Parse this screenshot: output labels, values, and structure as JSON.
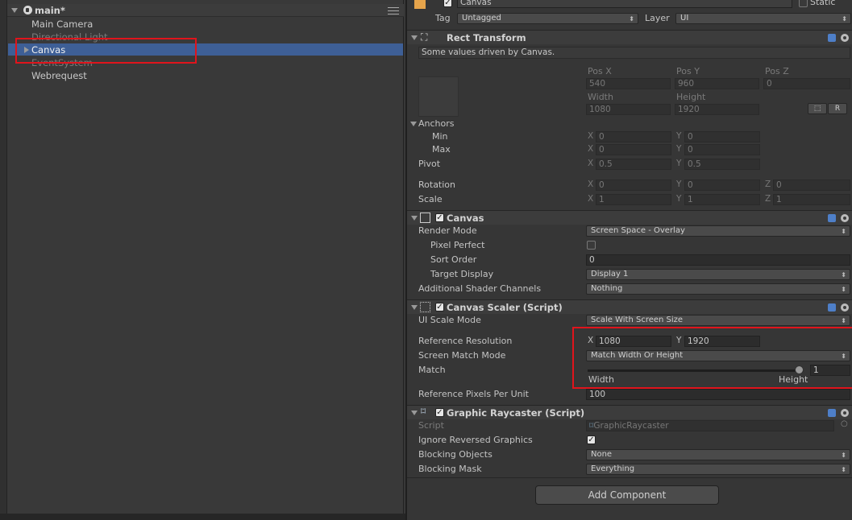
{
  "hierarchy": {
    "scene_title": "main*",
    "items": [
      {
        "label": "Main Camera"
      },
      {
        "label": "Directional Light"
      },
      {
        "label": "Canvas"
      },
      {
        "label": "EventSystem"
      },
      {
        "label": "Webrequest"
      }
    ]
  },
  "inspector": {
    "object_name": "Canvas",
    "static_label": "Static",
    "tag_label": "Tag",
    "tag_value": "Untagged",
    "layer_label": "Layer",
    "layer_value": "UI",
    "rect_transform": {
      "title": "Rect Transform",
      "info": "Some values driven by Canvas.",
      "pos_x_label": "Pos X",
      "pos_y_label": "Pos Y",
      "pos_z_label": "Pos Z",
      "pos_x": "540",
      "pos_y": "960",
      "pos_z": "0",
      "width_label": "Width",
      "height_label": "Height",
      "width": "1080",
      "height": "1920",
      "r_button": "R",
      "anchors_label": "Anchors",
      "min_label": "Min",
      "max_label": "Max",
      "min_x": "0",
      "min_y": "0",
      "max_x": "0",
      "max_y": "0",
      "pivot_label": "Pivot",
      "pivot_x": "0.5",
      "pivot_y": "0.5",
      "rotation_label": "Rotation",
      "rot_x": "0",
      "rot_y": "0",
      "rot_z": "0",
      "scale_label": "Scale",
      "scale_x": "1",
      "scale_y": "1",
      "scale_z": "1",
      "axis_x": "X",
      "axis_y": "Y",
      "axis_z": "Z"
    },
    "canvas": {
      "title": "Canvas",
      "render_mode_label": "Render Mode",
      "render_mode": "Screen Space - Overlay",
      "pixel_perfect_label": "Pixel Perfect",
      "sort_order_label": "Sort Order",
      "sort_order": "0",
      "target_display_label": "Target Display",
      "target_display": "Display 1",
      "shader_channels_label": "Additional Shader Channels",
      "shader_channels": "Nothing"
    },
    "canvas_scaler": {
      "title": "Canvas Scaler (Script)",
      "ui_scale_mode_label": "UI Scale Mode",
      "ui_scale_mode": "Scale With Screen Size",
      "ref_res_label": "Reference Resolution",
      "ref_x": "1080",
      "ref_y": "1920",
      "match_mode_label": "Screen Match Mode",
      "match_mode": "Match Width Or Height",
      "match_label": "Match",
      "match_value": "1",
      "match_fraction": 1,
      "width_label": "Width",
      "height_label": "Height",
      "ref_ppu_label": "Reference Pixels Per Unit",
      "ref_ppu": "100"
    },
    "graphic_raycaster": {
      "title": "Graphic Raycaster (Script)",
      "script_label": "Script",
      "script_value": "GraphicRaycaster",
      "ignore_reversed_label": "Ignore Reversed Graphics",
      "blocking_objects_label": "Blocking Objects",
      "blocking_objects": "None",
      "blocking_mask_label": "Blocking Mask",
      "blocking_mask": "Everything"
    },
    "add_component": "Add Component"
  }
}
